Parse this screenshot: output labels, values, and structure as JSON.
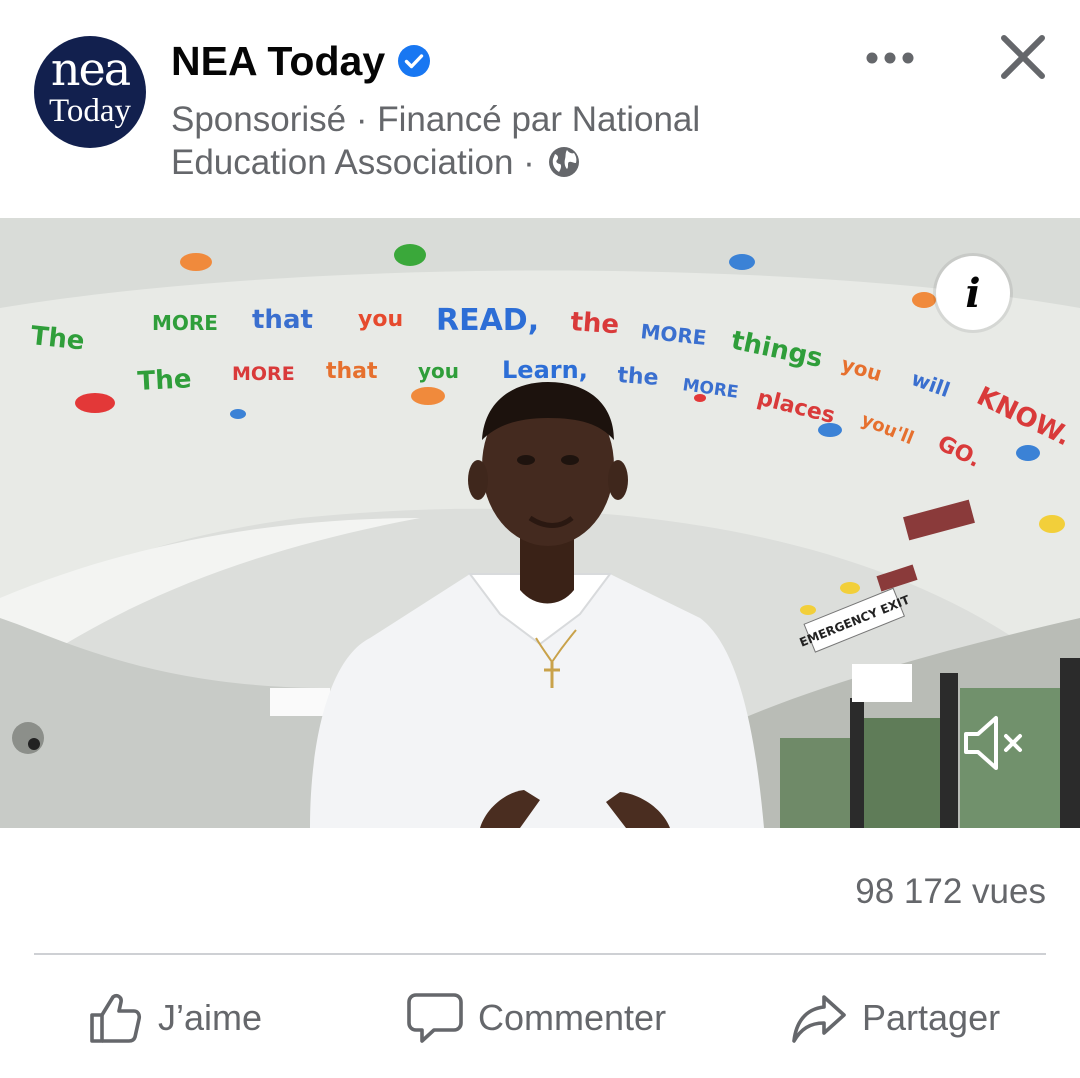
{
  "post": {
    "page_name": "NEA Today",
    "avatar": {
      "line1": "nea",
      "line2": "Today"
    },
    "meta_line1": "Sponsorisé · Financé par National",
    "meta_line2": "Education Association ·",
    "icons": [
      "verified-badge-icon",
      "globe-icon",
      "more-options-icon",
      "close-icon"
    ],
    "accent_color": "#1877f2"
  },
  "video": {
    "banner_line1": "The more that you READ, the more things you will KNOW.",
    "banner_line2": "The more that you Learn, the more places you'll GO.",
    "sign": "EMERGENCY EXIT",
    "info_label": "i",
    "icons": [
      "info-icon",
      "muted-speaker-icon"
    ]
  },
  "stats": {
    "views": "98 172 vues"
  },
  "actions": {
    "like": "J’aime",
    "comment": "Commenter",
    "share": "Partager"
  }
}
